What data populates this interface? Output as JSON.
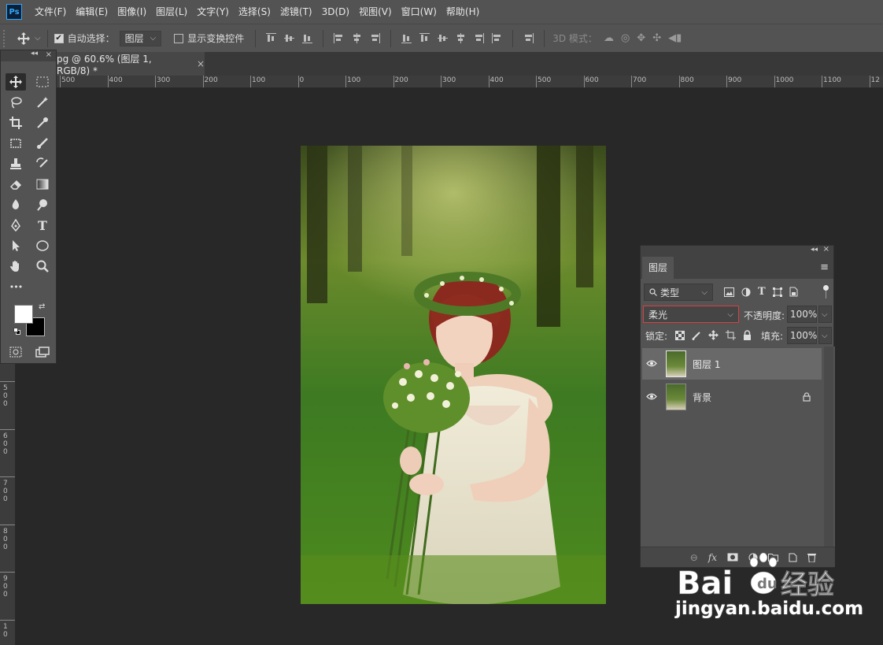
{
  "app": {
    "logo": "Ps"
  },
  "menu": [
    "文件(F)",
    "编辑(E)",
    "图像(I)",
    "图层(L)",
    "文字(Y)",
    "选择(S)",
    "滤镜(T)",
    "3D(D)",
    "视图(V)",
    "窗口(W)",
    "帮助(H)"
  ],
  "options": {
    "auto_select_label": "自动选择：",
    "auto_select_checked": true,
    "auto_select_target": "图层",
    "show_transform_label": "显示变换控件",
    "mode_3d_label": "3D 模式："
  },
  "document": {
    "tab_title": "pg @ 60.6% (图层 1, RGB/8) *",
    "close": "×"
  },
  "rulers": {
    "top": [
      "500",
      "400",
      "300",
      "200",
      "100",
      "0",
      "100",
      "200",
      "300",
      "400",
      "500",
      "600",
      "700",
      "800",
      "900",
      "1000",
      "1100",
      "12"
    ],
    "left": [
      [
        "5",
        "0",
        "0"
      ],
      [
        "6",
        "0",
        "0"
      ],
      [
        "7",
        "0",
        "0"
      ],
      [
        "8",
        "0",
        "0"
      ],
      [
        "9",
        "0",
        "0"
      ],
      [
        "1",
        "0"
      ]
    ]
  },
  "tools_panel": {
    "expand": "◂◂",
    "close": "×",
    "more": "•••"
  },
  "layers_panel": {
    "tab": "图层",
    "collapse": "◂◂",
    "close": "×",
    "menu": "≡",
    "filter_kind": "类型",
    "blend_mode": "柔光",
    "opacity_label": "不透明度:",
    "opacity_value": "100%",
    "lock_label": "锁定:",
    "fill_label": "填充:",
    "fill_value": "100%",
    "layers": [
      {
        "name": "图层 1",
        "selected": true,
        "locked": false
      },
      {
        "name": "背景",
        "selected": false,
        "locked": true
      }
    ],
    "footer_fx": "fx"
  },
  "watermark": {
    "brand": "Bai",
    "brand2": "经验",
    "url": "jingyan.baidu.com"
  },
  "colors": {
    "accent": "#31a8ff",
    "highlight_border": "#d94040"
  }
}
